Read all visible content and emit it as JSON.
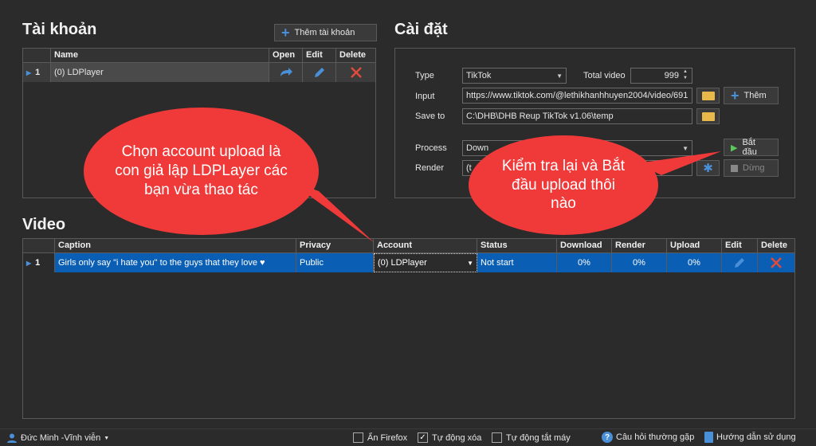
{
  "accounts": {
    "title": "Tài khoản",
    "add_button": "Thêm tài khoản",
    "columns": [
      "Name",
      "Open",
      "Edit",
      "Delete"
    ],
    "rows": [
      {
        "index": "1",
        "name": "(0) LDPlayer"
      }
    ]
  },
  "settings": {
    "title": "Cài đặt",
    "type_label": "Type",
    "type_value": "TikTok",
    "total_video_label": "Total video",
    "total_video_value": "999",
    "input_label": "Input",
    "input_value": "https://www.tiktok.com/@lethikhanhhuyen2004/video/691",
    "add_button": "Thêm",
    "save_to_label": "Save to",
    "save_to_value": "C:\\DHB\\DHB Reup TikTok v1.06\\temp",
    "process_label": "Process",
    "process_value": "Down",
    "render_label": "Render",
    "render_value": "(t",
    "start_button": "Bắt đầu",
    "stop_button": "Dừng"
  },
  "video": {
    "title": "Video",
    "columns": [
      "Caption",
      "Privacy",
      "Account",
      "Status",
      "Download",
      "Render",
      "Upload",
      "Edit",
      "Delete"
    ],
    "rows": [
      {
        "index": "1",
        "caption": "Girls only say \"i hate you\" to the guys that they love ♥",
        "privacy": "Public",
        "account": "(0) LDPlayer",
        "status": "Not start",
        "download": "0%",
        "render": "0%",
        "upload": "0%"
      }
    ]
  },
  "callouts": {
    "left": "Chọn account upload là con giả lập LDPLayer các bạn vừa thao tác",
    "right": "Kiểm tra lại và Bắt đầu upload thôi nào"
  },
  "statusbar": {
    "user": "Đức Minh -Vĩnh viễn",
    "hide_firefox": "Ẩn Firefox",
    "auto_delete": "Tự động xóa",
    "auto_shutdown": "Tự động tắt máy",
    "faq": "Câu hỏi thường gặp",
    "guide": "Hướng dẫn sử dụng",
    "hide_firefox_checked": false,
    "auto_delete_checked": true,
    "auto_shutdown_checked": false
  },
  "colors": {
    "background": "#2b2b2b",
    "selected_row": "#0a5fb4",
    "callout": "#f03a3a",
    "accent_blue": "#4a90d9",
    "delete_red": "#e04b3a"
  }
}
